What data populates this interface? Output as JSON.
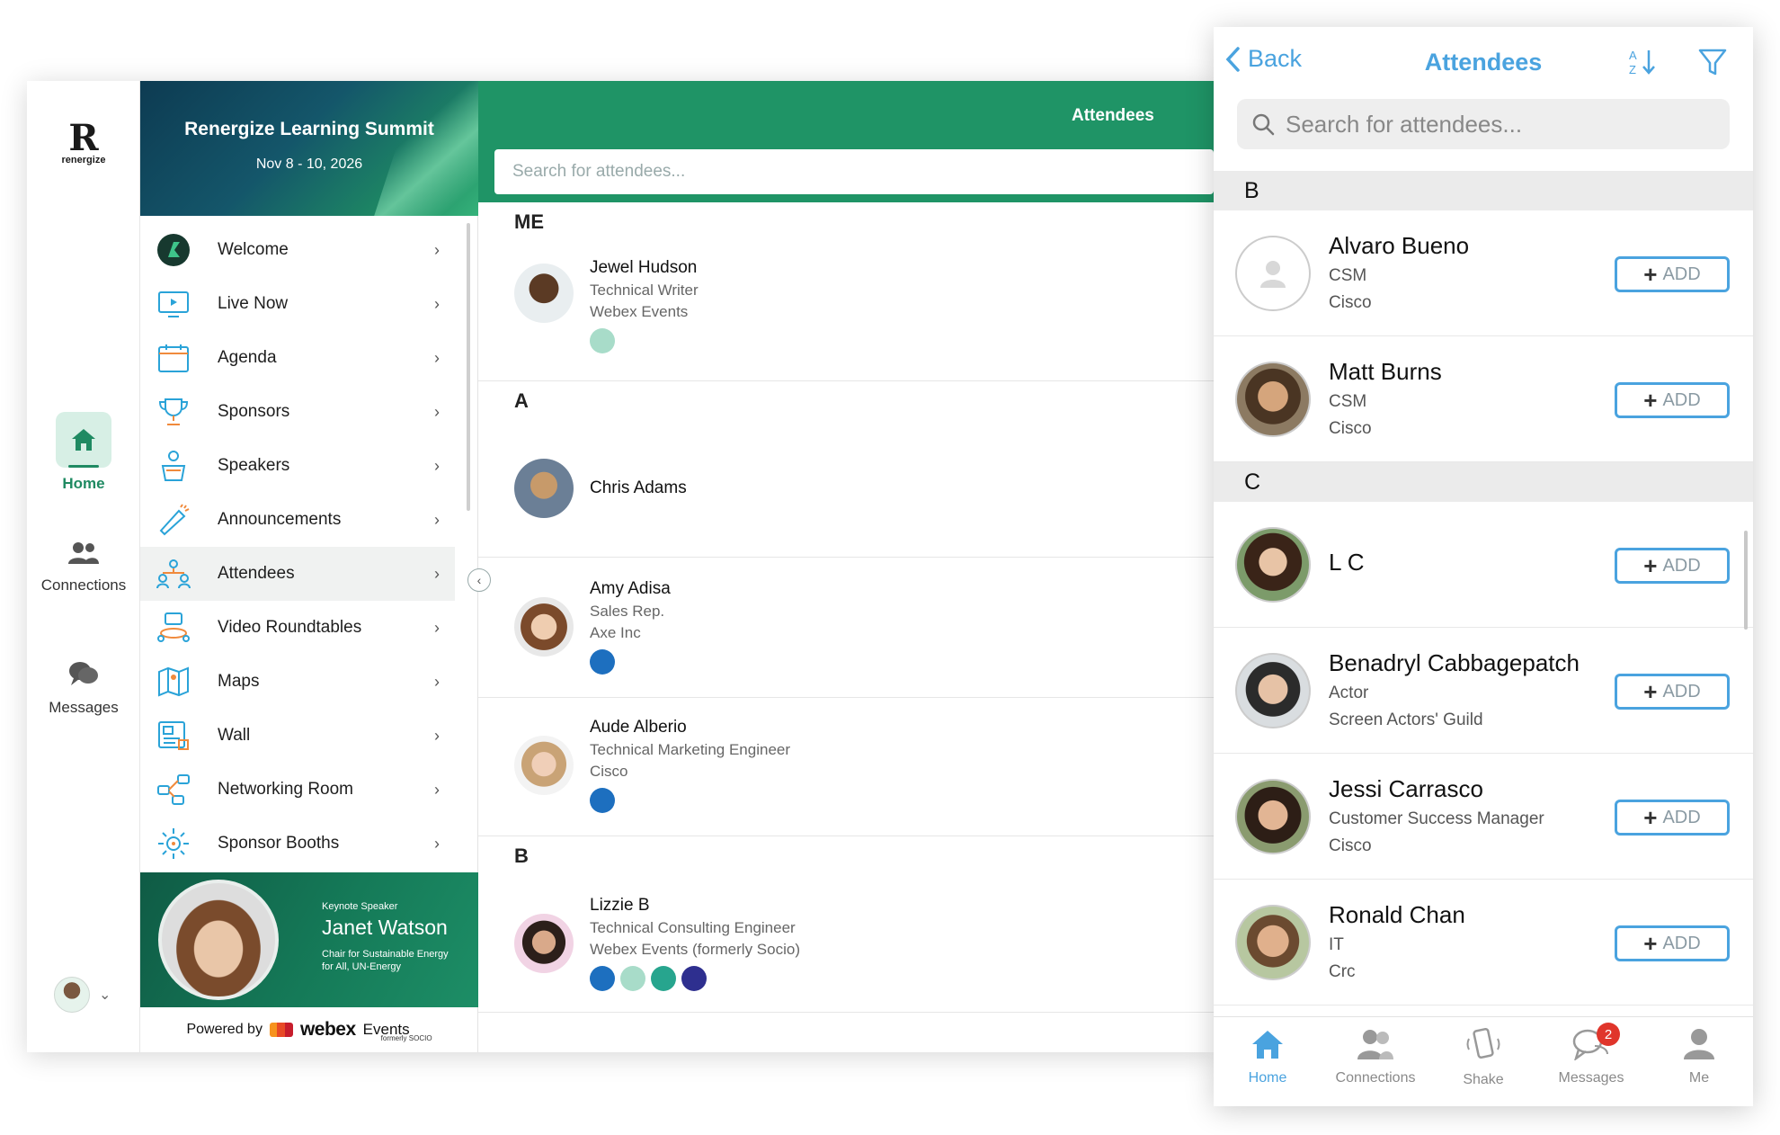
{
  "rail": {
    "logo_mark": "R",
    "logo_word": "renergize",
    "items": [
      {
        "label": "Home",
        "icon": "home-icon",
        "active": true
      },
      {
        "label": "Connections",
        "icon": "people-icon"
      },
      {
        "label": "Messages",
        "icon": "chat-icon"
      }
    ]
  },
  "event": {
    "title": "Renergize Learning Summit",
    "dates": "Nov 8 - 10, 2026"
  },
  "menu": {
    "items": [
      {
        "label": "Welcome",
        "icon": "welcome-logo-icon"
      },
      {
        "label": "Live Now",
        "icon": "live-screen-icon"
      },
      {
        "label": "Agenda",
        "icon": "calendar-icon"
      },
      {
        "label": "Sponsors",
        "icon": "trophy-icon"
      },
      {
        "label": "Speakers",
        "icon": "podium-icon"
      },
      {
        "label": "Announcements",
        "icon": "megaphone-icon"
      },
      {
        "label": "Attendees",
        "icon": "attendees-icon",
        "active": true
      },
      {
        "label": "Video Roundtables",
        "icon": "roundtable-icon"
      },
      {
        "label": "Maps",
        "icon": "map-icon"
      },
      {
        "label": "Wall",
        "icon": "wall-icon"
      },
      {
        "label": "Networking Room",
        "icon": "network-icon"
      },
      {
        "label": "Sponsor Booths",
        "icon": "booth-icon"
      }
    ]
  },
  "keynote": {
    "kicker": "Keynote Speaker",
    "name": "Janet Watson",
    "role": "Chair for Sustainable Energy for All, UN-Energy"
  },
  "powered": {
    "prefix": "Powered by",
    "brand": "webex",
    "product": "Events",
    "formerly": "formerly SOCIO"
  },
  "main": {
    "title": "Attendees",
    "search_placeholder": "Search for attendees...",
    "sections": [
      {
        "letter": "ME",
        "people": [
          {
            "name": "Jewel Hudson",
            "title": "Technical Writer",
            "company": "Webex Events",
            "dots": [
              "#a8dcc9"
            ]
          }
        ]
      },
      {
        "letter": "A",
        "people": [
          {
            "name": "Chris Adams",
            "title": "",
            "company": "",
            "dots": []
          },
          {
            "name": "Amy Adisa",
            "title": "Sales Rep.",
            "company": "Axe Inc",
            "dots": [
              "#1d6fbf"
            ]
          },
          {
            "name": "Aude Alberio",
            "title": "Technical Marketing Engineer",
            "company": "Cisco",
            "dots": [
              "#1d6fbf"
            ]
          }
        ]
      },
      {
        "letter": "B",
        "people": [
          {
            "name": "Lizzie B",
            "title": "Technical Consulting Engineer",
            "company": "Webex Events (formerly Socio)",
            "dots": [
              "#1d6fbf",
              "#a8dcc9",
              "#27a58e",
              "#2e2f8f"
            ]
          }
        ]
      }
    ]
  },
  "phone": {
    "back_label": "Back",
    "title": "Attendees",
    "search_placeholder": "Search for attendees...",
    "add_label": "ADD",
    "sections": [
      {
        "letter": "B",
        "people": [
          {
            "name": "Alvaro Bueno",
            "title": "CSM",
            "company": "Cisco",
            "placeholder": true
          },
          {
            "name": "Matt Burns",
            "title": "CSM",
            "company": "Cisco"
          }
        ]
      },
      {
        "letter": "C",
        "people": [
          {
            "name": "L C",
            "title": "",
            "company": ""
          },
          {
            "name": "Benadryl Cabbagepatch",
            "title": "Actor",
            "company": "Screen Actors' Guild"
          },
          {
            "name": "Jessi Carrasco",
            "title": "Customer Success Manager",
            "company": "Cisco"
          },
          {
            "name": "Ronald Chan",
            "title": "IT",
            "company": "Crc"
          }
        ]
      }
    ],
    "tabs": [
      {
        "label": "Home",
        "icon": "home-icon",
        "active": true
      },
      {
        "label": "Connections",
        "icon": "connections-icon"
      },
      {
        "label": "Shake",
        "icon": "shake-phone-icon"
      },
      {
        "label": "Messages",
        "icon": "messages-icon",
        "badge": "2"
      },
      {
        "label": "Me",
        "icon": "person-icon"
      }
    ]
  },
  "colors": {
    "brand_green": "#1f9466",
    "phone_accent": "#4aa3df",
    "badge_red": "#e0352b"
  }
}
